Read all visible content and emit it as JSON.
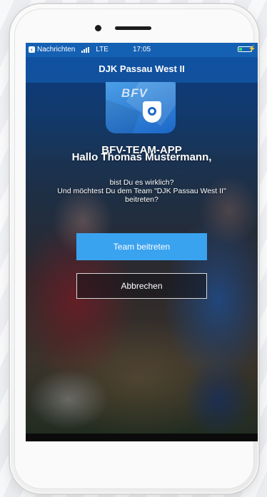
{
  "status_bar": {
    "back_app": "Nachrichten",
    "network": "LTE",
    "time": "17:05",
    "battery_level": 0.25,
    "charging": "⚡"
  },
  "nav": {
    "title": "DJK Passau West II"
  },
  "app": {
    "icon_text": "BFV",
    "name": "BFV-TEAM-APP"
  },
  "dialog": {
    "greeting": "Hallo Thomas Mustermann,",
    "question_line1": "bist Du es wirklich?",
    "question_line2": "Und möchtest Du dem Team \"DJK Passau West II\" beitreten?",
    "join_label": "Team beitreten",
    "cancel_label": "Abbrechen"
  },
  "colors": {
    "accent": "#3aa3f0",
    "status_bar": "#1461b4"
  }
}
